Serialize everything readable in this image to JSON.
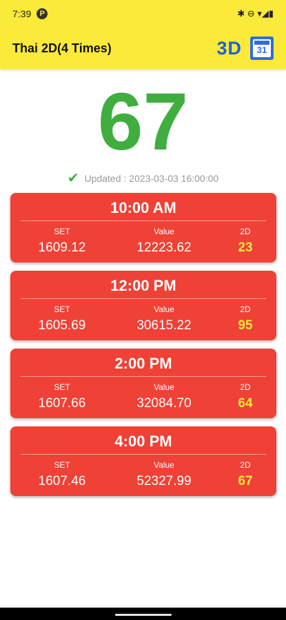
{
  "status_bar": {
    "time": "7:39",
    "notification_icon": "P",
    "right_icons": "✱ ⊖ ▾◢▮"
  },
  "app_bar": {
    "title": "Thai 2D(4 Times)",
    "btn_3d_label": "3D",
    "calendar_day": "31"
  },
  "main": {
    "big_number": "67",
    "updated_text": "Updated : 2023-03-03 16:00:00"
  },
  "results": [
    {
      "time": "10:00 AM",
      "set_label": "SET",
      "value_label": "Value",
      "d2_label": "2D",
      "set": "1609.12",
      "value": "12223.62",
      "d2": "23"
    },
    {
      "time": "12:00 PM",
      "set_label": "SET",
      "value_label": "Value",
      "d2_label": "2D",
      "set": "1605.69",
      "value": "30615.22",
      "d2": "95"
    },
    {
      "time": "2:00 PM",
      "set_label": "SET",
      "value_label": "Value",
      "d2_label": "2D",
      "set": "1607.66",
      "value": "32084.70",
      "d2": "64"
    },
    {
      "time": "4:00 PM",
      "set_label": "SET",
      "value_label": "Value",
      "d2_label": "2D",
      "set": "1607.46",
      "value": "52327.99",
      "d2": "67"
    }
  ],
  "colors": {
    "appbar_bg": "#fbea3a",
    "card_bg": "#ef4136",
    "big_number": "#3fae3f",
    "accent_blue": "#1e5fd6",
    "d2_value": "#fbe93a"
  }
}
